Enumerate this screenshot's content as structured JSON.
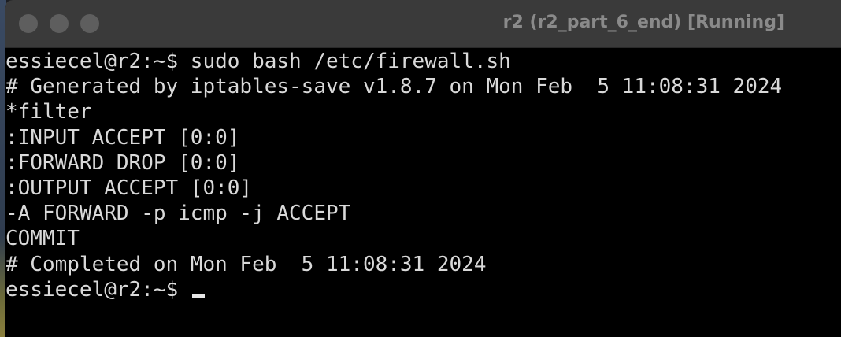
{
  "window": {
    "title": "r2 (r2_part_6_end) [Running]",
    "buttons": [
      "close",
      "minimize",
      "zoom"
    ]
  },
  "terminal": {
    "lines": [
      "essiecel@r2:~$ sudo bash /etc/firewall.sh",
      "# Generated by iptables-save v1.8.7 on Mon Feb  5 11:08:31 2024",
      "*filter",
      ":INPUT ACCEPT [0:0]",
      ":FORWARD DROP [0:0]",
      ":OUTPUT ACCEPT [0:0]",
      "-A FORWARD -p icmp -j ACCEPT",
      "COMMIT",
      "# Completed on Mon Feb  5 11:08:31 2024"
    ],
    "prompt": "essiecel@r2:~$ "
  }
}
